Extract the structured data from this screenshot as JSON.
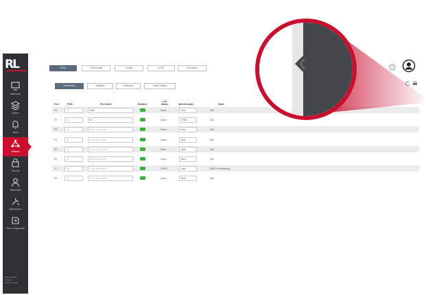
{
  "logo": {
    "text": "RL"
  },
  "sidebar": {
    "items": [
      {
        "label": "Dashboard",
        "icon": "monitor-icon"
      },
      {
        "label": "System",
        "icon": "layers-icon"
      },
      {
        "label": "Alarm",
        "icon": "bell-icon"
      },
      {
        "label": "Network",
        "icon": "network-icon",
        "active": true
      },
      {
        "label": "Security",
        "icon": "lock-icon"
      },
      {
        "label": "Diagnostics",
        "icon": "user-icon"
      },
      {
        "label": "Maintenance",
        "icon": "tools-icon"
      },
      {
        "label": "Save Configuration",
        "icon": "save-icon"
      }
    ],
    "footer": [
      "Model: RSG2",
      "Version",
      "Serial Number"
    ]
  },
  "tabs": [
    "Ports",
    "Port Config",
    "Trunks",
    "LLDP",
    "Port Mirror"
  ],
  "subtabs": [
    "Parameters",
    "Statistics",
    "Advanced",
    "Rate Limiting"
  ],
  "table": {
    "headers": {
      "port": "Port",
      "pvid": "PVID",
      "name": "Port name",
      "enabled": "Enabled",
      "link": "Link Status",
      "speed": "Speed/Duplex",
      "mode": "Mode"
    },
    "rows": [
      {
        "port": "P1",
        "pvid": "1",
        "name": "Main",
        "placeholder": false,
        "link": "Down",
        "speed": "Auto",
        "mode": "N/A"
      },
      {
        "port": "P2",
        "pvid": "1",
        "name": "ttt",
        "placeholder": false,
        "link": "Down",
        "speed": "10HD",
        "mode": "N/A"
      },
      {
        "port": "P3",
        "pvid": "1",
        "name": "Enter port name",
        "placeholder": true,
        "link": "Down",
        "speed": "Auto",
        "mode": "N/A"
      },
      {
        "port": "P4",
        "pvid": "1",
        "name": "Enter port name",
        "placeholder": true,
        "link": "Down",
        "speed": "Auto",
        "mode": "N/A"
      },
      {
        "port": "P5",
        "pvid": "1",
        "name": "Enter port name",
        "placeholder": true,
        "link": "Down",
        "speed": "Auto",
        "mode": "N/A"
      },
      {
        "port": "P6",
        "pvid": "1",
        "name": "Enter port name",
        "placeholder": true,
        "link": "Down",
        "speed": "Auto",
        "mode": "N/A"
      },
      {
        "port": "P7",
        "pvid": "1",
        "name": "Enter port name",
        "placeholder": true,
        "link": "100FD",
        "speed": "Auto",
        "mode": "SW/TX Forwarding"
      },
      {
        "port": "P8",
        "pvid": "1",
        "name": "Enter port name",
        "placeholder": true,
        "link": "Down",
        "speed": "Auto",
        "mode": "N/A"
      }
    ]
  },
  "colors": {
    "brand": "#c8102e",
    "sidebar": "#2e3033",
    "accent": "#5a6b7c",
    "enabled": "#3cb043"
  }
}
